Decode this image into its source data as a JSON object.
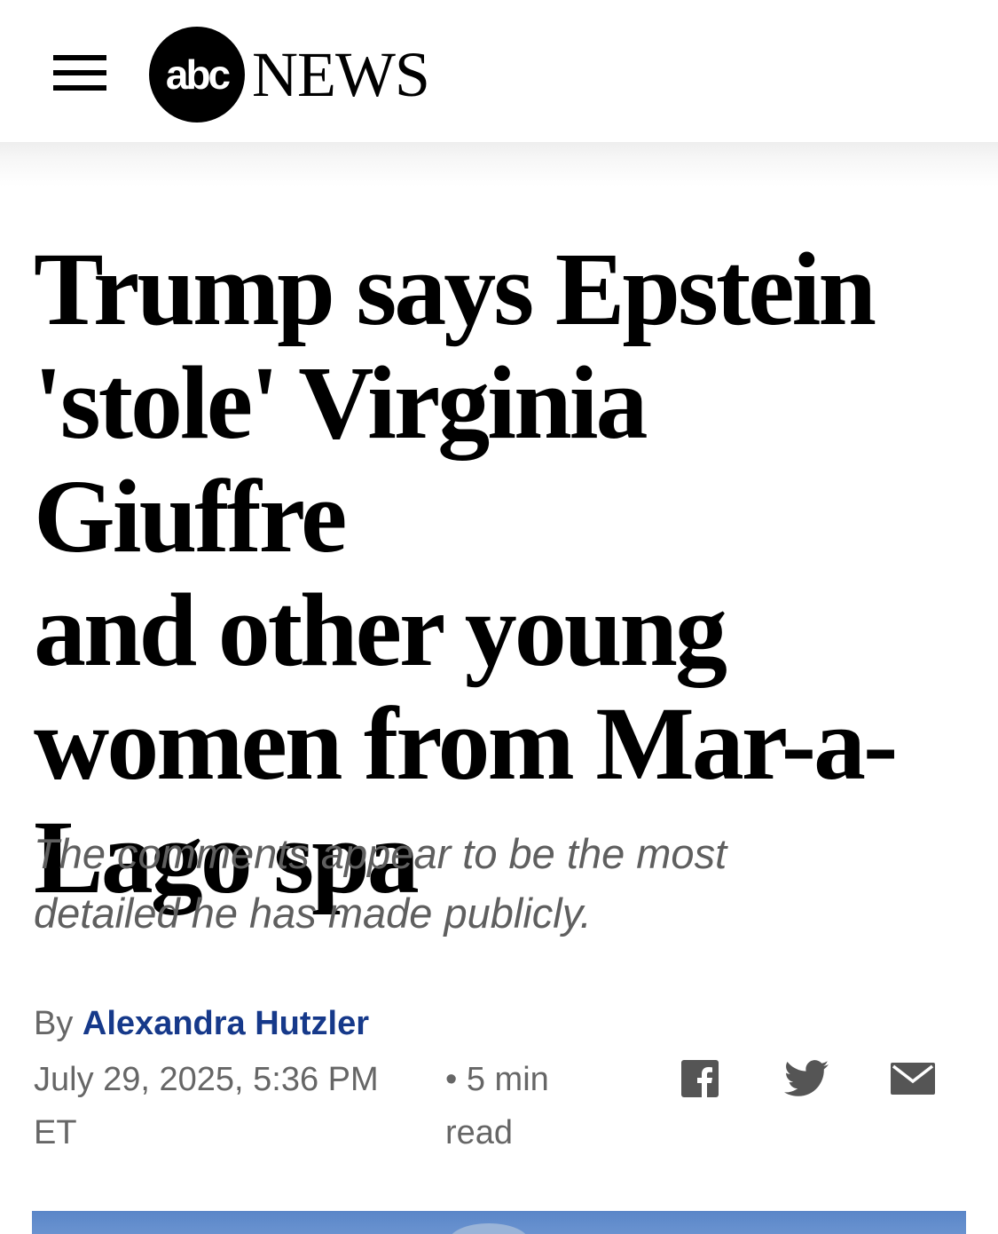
{
  "header": {
    "menu_icon": "hamburger-menu-icon",
    "logo": {
      "abc": "abc",
      "news": "NEWS"
    }
  },
  "article": {
    "headline_lines": [
      "Trump says Epstein",
      "'stole' Virginia Giuffre",
      "and other young",
      "women from Mar-a-",
      "Lago spa"
    ],
    "subheadline_lines": [
      "The comments appear to be the most",
      "detailed he has made publicly."
    ],
    "byline_prefix": "By",
    "author": "Alexandra Hutzler",
    "date_line1": "July 29, 2025, 5:36 PM",
    "date_line2": "ET",
    "read_time_line1": "• 5 min",
    "read_time_line2": "read"
  },
  "share": {
    "icons": [
      "facebook-icon",
      "twitter-icon",
      "email-icon"
    ]
  },
  "colors": {
    "author_link": "#16398a",
    "meta_text": "#666666",
    "subhead_text": "#5f5f5f",
    "hero_sky": "#5a86c8"
  }
}
